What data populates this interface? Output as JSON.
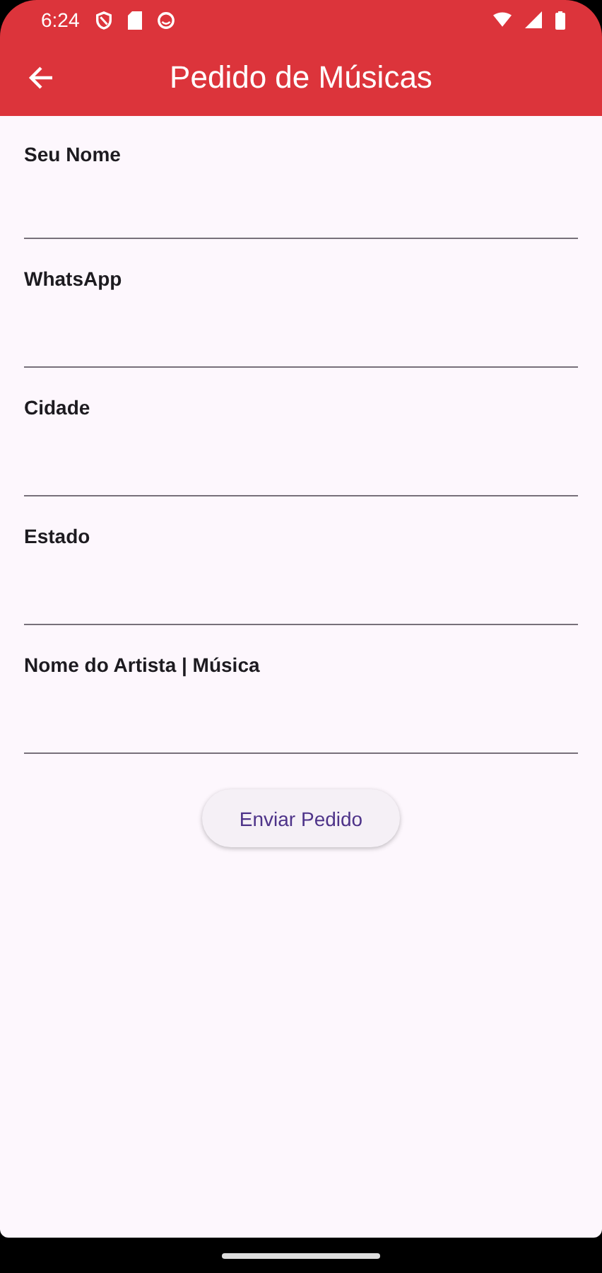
{
  "status_bar": {
    "time": "6:24"
  },
  "app_bar": {
    "title": "Pedido de Músicas"
  },
  "fields": [
    {
      "label": "Seu Nome"
    },
    {
      "label": "WhatsApp"
    },
    {
      "label": "Cidade"
    },
    {
      "label": "Estado"
    },
    {
      "label": "Nome do Artista | Música"
    }
  ],
  "submit_button": {
    "label": "Enviar Pedido"
  }
}
